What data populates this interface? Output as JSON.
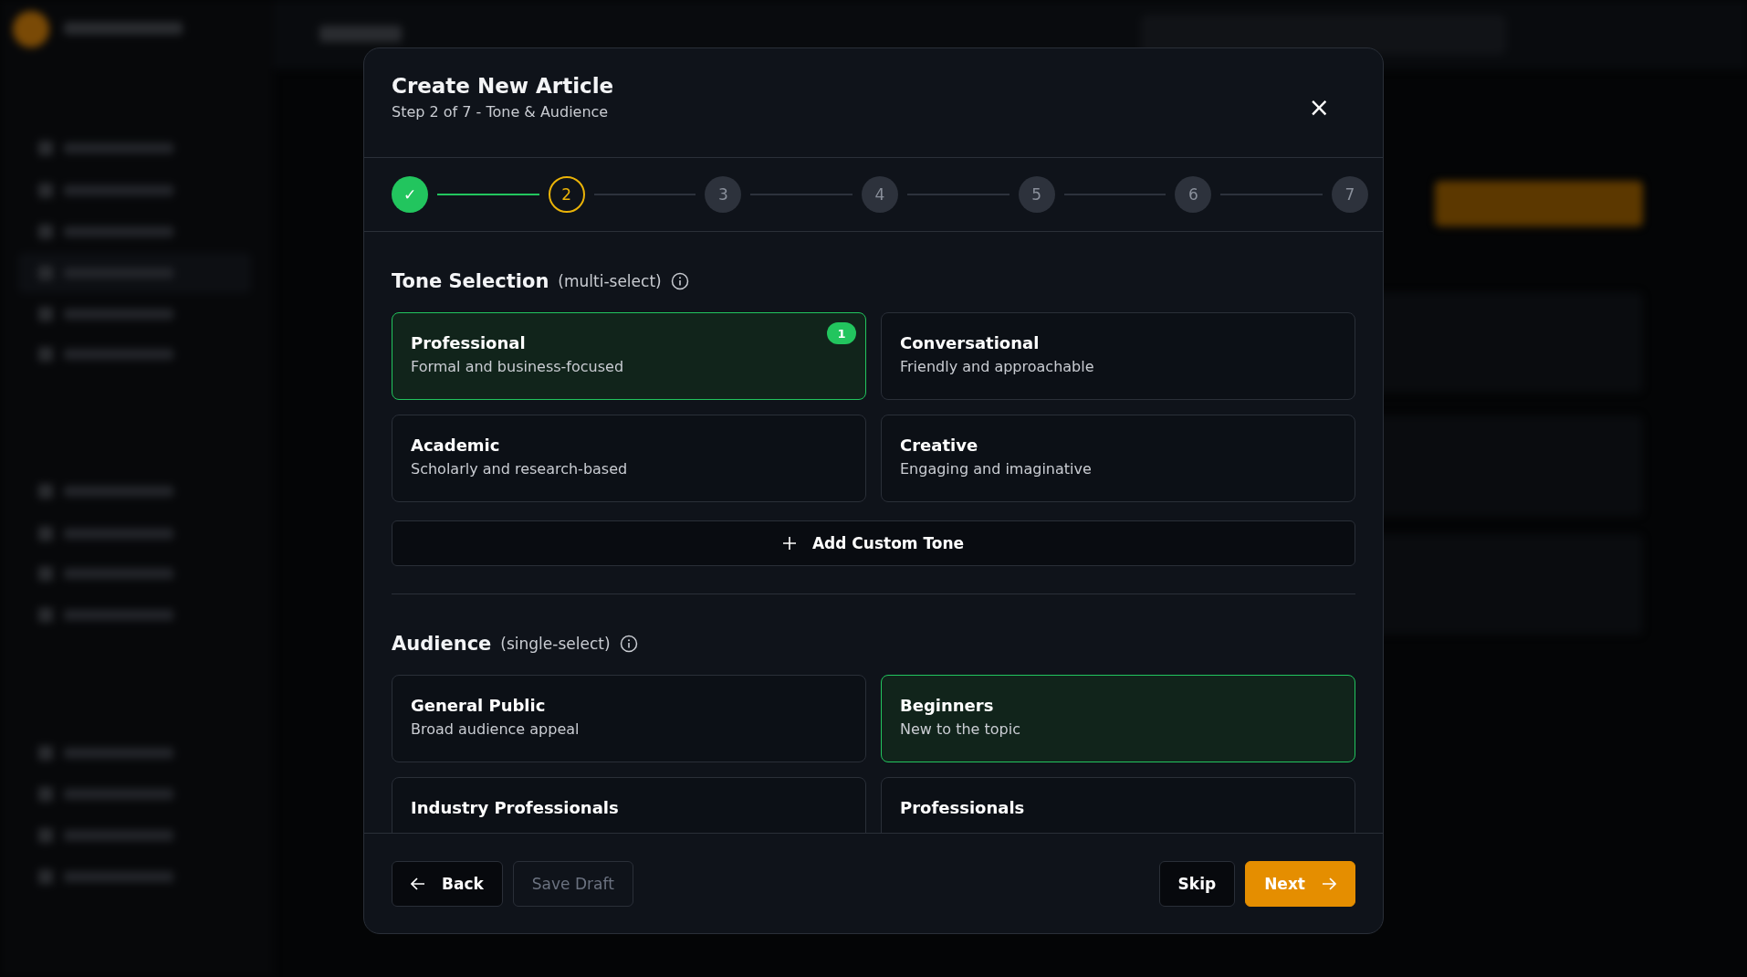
{
  "dialog": {
    "title": "Create New Article",
    "subtitle": "Step 2 of 7 - Tone & Audience",
    "close": "×"
  },
  "steps": [
    {
      "label": "✓",
      "done": true,
      "current": false
    },
    {
      "label": "2",
      "done": false,
      "current": true
    },
    {
      "label": "3",
      "done": false,
      "current": false
    },
    {
      "label": "4",
      "done": false,
      "current": false
    },
    {
      "label": "5",
      "done": false,
      "current": false
    },
    {
      "label": "6",
      "done": false,
      "current": false
    },
    {
      "label": "7",
      "done": false,
      "current": false
    }
  ],
  "tone": {
    "title": "Tone Selection",
    "hint": "(multi-select)",
    "options": [
      {
        "name": "Professional",
        "description": "Formal and business-focused",
        "selected": true,
        "order": "1"
      },
      {
        "name": "Conversational",
        "description": "Friendly and approachable",
        "selected": false
      },
      {
        "name": "Academic",
        "description": "Scholarly and research-based",
        "selected": false
      },
      {
        "name": "Creative",
        "description": "Engaging and imaginative",
        "selected": false
      }
    ],
    "add_button": "Add Custom Tone"
  },
  "audience": {
    "title": "Audience",
    "hint": "(single-select)",
    "options": [
      {
        "name": "General Public",
        "description": "Broad audience appeal",
        "selected": false
      },
      {
        "name": "Beginners",
        "description": "New to the topic",
        "selected": true
      },
      {
        "name": "Industry Professionals",
        "selected": false
      },
      {
        "name": "Professionals",
        "selected": false
      }
    ]
  },
  "footer": {
    "back": "Back",
    "save_draft": "Save Draft",
    "save_draft_disabled": true,
    "skip": "Skip",
    "next": "Next"
  }
}
